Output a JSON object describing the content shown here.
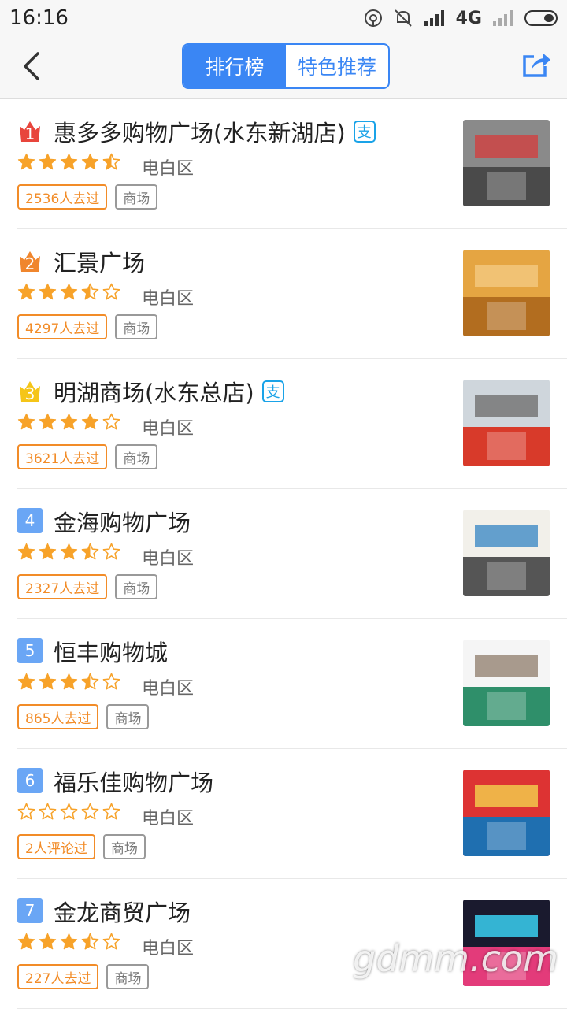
{
  "status_bar": {
    "time": "16:16",
    "network": "4G"
  },
  "tabs": [
    {
      "label": "排行榜",
      "active": true
    },
    {
      "label": "特色推荐",
      "active": false
    }
  ],
  "items": [
    {
      "rank": "1",
      "title": "惠多多购物广场(水东新湖店)",
      "alipay": true,
      "rating": 4.5,
      "district": "电白区",
      "visits": "2536人去过",
      "category": "商场"
    },
    {
      "rank": "2",
      "title": "汇景广场",
      "alipay": false,
      "rating": 3.5,
      "district": "电白区",
      "visits": "4297人去过",
      "category": "商场"
    },
    {
      "rank": "3",
      "title": "明湖商场(水东总店)",
      "alipay": true,
      "rating": 4,
      "district": "电白区",
      "visits": "3621人去过",
      "category": "商场"
    },
    {
      "rank": "4",
      "title": "金海购物广场",
      "alipay": false,
      "rating": 3.5,
      "district": "电白区",
      "visits": "2327人去过",
      "category": "商场"
    },
    {
      "rank": "5",
      "title": "恒丰购物城",
      "alipay": false,
      "rating": 3.5,
      "district": "电白区",
      "visits": "865人去过",
      "category": "商场"
    },
    {
      "rank": "6",
      "title": "福乐佳购物广场",
      "alipay": false,
      "rating": 0,
      "district": "电白区",
      "visits": "2人评论过",
      "category": "商场"
    },
    {
      "rank": "7",
      "title": "金龙商贸广场",
      "alipay": false,
      "rating": 3.5,
      "district": "电白区",
      "visits": "227人去过",
      "category": "商场"
    }
  ],
  "colors": {
    "accent": "#3a86f4",
    "star": "#f7a229",
    "tag_orange": "#f28c28",
    "rank1": "#e8453c",
    "rank2": "#f0862d",
    "rank3": "#f5c518"
  },
  "watermark": "gdmm.com"
}
